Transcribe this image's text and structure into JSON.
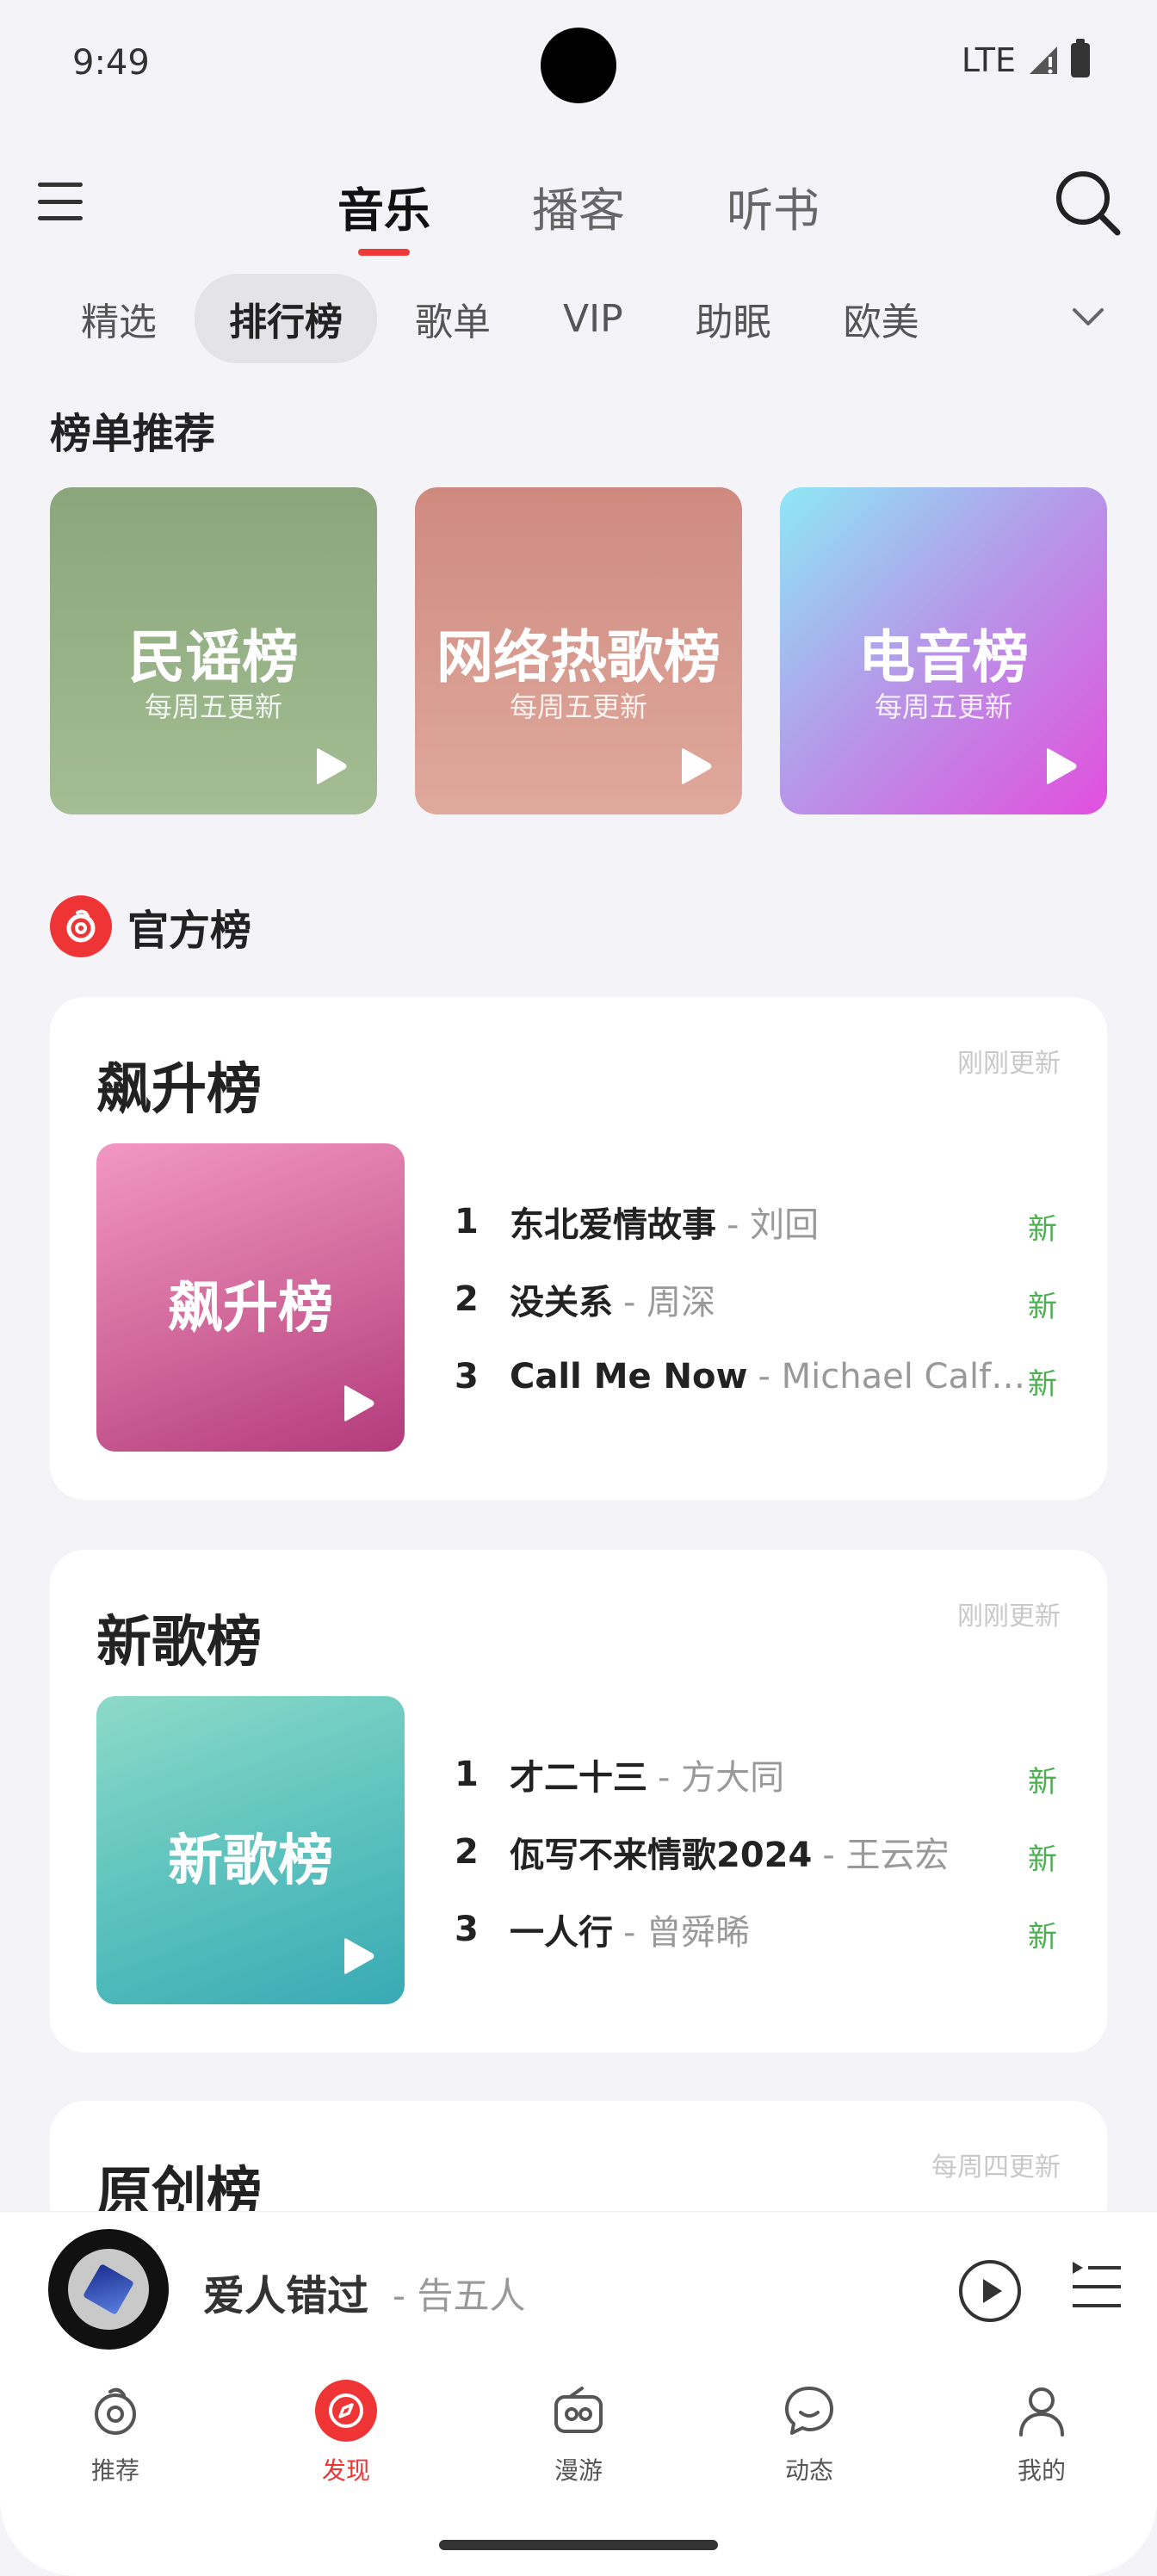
{
  "status_bar": {
    "time": "9:49",
    "network": "LTE"
  },
  "header": {
    "tabs": [
      {
        "label": "音乐",
        "active": true
      },
      {
        "label": "播客",
        "active": false
      },
      {
        "label": "听书",
        "active": false
      }
    ]
  },
  "sub_tabs": [
    {
      "label": "精选",
      "active": false
    },
    {
      "label": "排行榜",
      "active": true
    },
    {
      "label": "歌单",
      "active": false
    },
    {
      "label": "VIP",
      "active": false
    },
    {
      "label": "助眠",
      "active": false
    },
    {
      "label": "欧美",
      "active": false
    }
  ],
  "recommend": {
    "title": "榜单推荐",
    "cards": [
      {
        "name": "民谣榜",
        "sub": "每周五更新"
      },
      {
        "name": "网络热歌榜",
        "sub": "每周五更新"
      },
      {
        "name": "电音榜",
        "sub": "每周五更新"
      }
    ]
  },
  "official": {
    "title": "官方榜",
    "charts": [
      {
        "title": "飙升榜",
        "updated": "刚刚更新",
        "cover": "飙升榜",
        "songs": [
          {
            "rank": "1",
            "title": "东北爱情故事",
            "artist": "- 刘回",
            "badge": "新"
          },
          {
            "rank": "2",
            "title": "没关系",
            "artist": "- 周深",
            "badge": "新"
          },
          {
            "rank": "3",
            "title": "Call Me Now",
            "artist": "- Michael Calfa...",
            "badge": "新"
          }
        ]
      },
      {
        "title": "新歌榜",
        "updated": "刚刚更新",
        "cover": "新歌榜",
        "songs": [
          {
            "rank": "1",
            "title": "才二十三",
            "artist": "- 方大同",
            "badge": "新"
          },
          {
            "rank": "2",
            "title": "佤写不来情歌2024",
            "artist": "- 王云宏",
            "badge": "新"
          },
          {
            "rank": "3",
            "title": "一人行",
            "artist": "- 曾舜晞",
            "badge": "新"
          }
        ]
      },
      {
        "title": "原创榜",
        "updated": "每周四更新"
      }
    ]
  },
  "now_playing": {
    "title": "爱人错过",
    "artist": "- 告五人"
  },
  "bottom_nav": [
    {
      "label": "推荐",
      "icon": "recommend-icon",
      "active": false
    },
    {
      "label": "发现",
      "icon": "discover-icon",
      "active": true
    },
    {
      "label": "漫游",
      "icon": "roam-icon",
      "active": false
    },
    {
      "label": "动态",
      "icon": "feed-icon",
      "active": false
    },
    {
      "label": "我的",
      "icon": "profile-icon",
      "active": false
    }
  ],
  "colors": {
    "accent": "#ee3434",
    "new_badge": "#4caf50",
    "background": "#f3f3f8"
  }
}
